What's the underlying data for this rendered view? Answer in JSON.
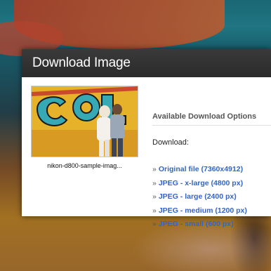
{
  "dialog": {
    "title": "Download Image",
    "thumbnail_caption": "nikon-d800-sample-imag...",
    "options_heading": "Available Download Options",
    "download_label": "Download:",
    "options": [
      {
        "label": "Original file (7360x4912)"
      },
      {
        "label": "JPEG - x-large (4800 px)"
      },
      {
        "label": "JPEG - large (2400 px)"
      },
      {
        "label": "JPEG - medium (1200 px)"
      },
      {
        "label": "JPEG - small (600 px)"
      }
    ],
    "bullet": "»"
  },
  "colors": {
    "header_bg": "#2f2f2f",
    "link": "#3465c4"
  }
}
